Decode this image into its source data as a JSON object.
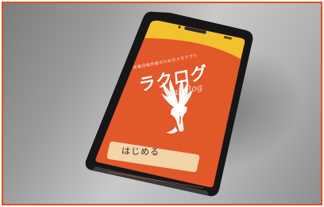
{
  "app": {
    "tagline": "作業日報作成のためのメモアプリ",
    "title": "ラクログ",
    "subtitle": "Rakulog",
    "logo": "deer-head-icon",
    "start_button_label": "はじめる"
  },
  "colors": {
    "screen_bg": "#e2582b",
    "banner_yellow": "#f3c12d",
    "button_bg": "#f4d3a8",
    "frame_border": "#e2501f",
    "phone_body": "#1a1a1a"
  }
}
